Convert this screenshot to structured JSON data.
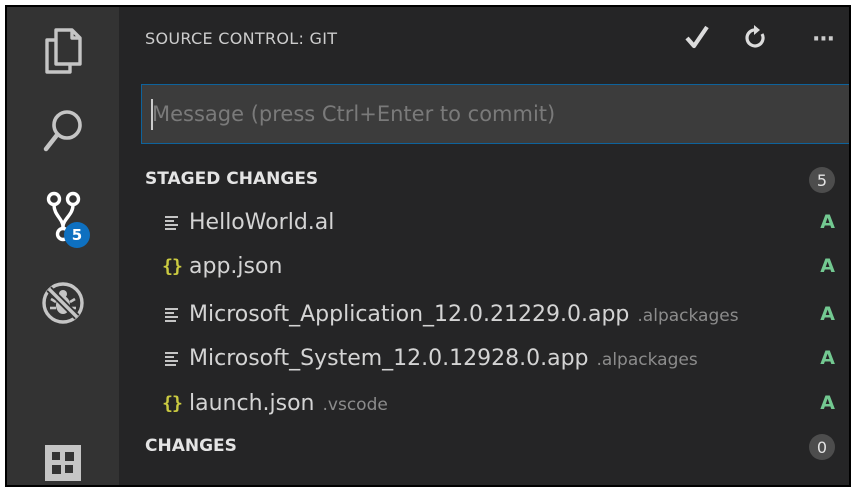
{
  "activity_bar": {
    "items": [
      {
        "icon": "files-icon"
      },
      {
        "icon": "search-icon"
      },
      {
        "icon": "source-control-icon",
        "badge": "5"
      },
      {
        "icon": "debug-icon"
      },
      {
        "icon": "extensions-icon"
      }
    ]
  },
  "panel": {
    "title": "SOURCE CONTROL: GIT",
    "actions": [
      "commit-check-icon",
      "refresh-icon",
      "more-icon"
    ],
    "more_label": "···",
    "message_placeholder": "Message (press Ctrl+Enter to commit)",
    "message_value": ""
  },
  "staged": {
    "label": "STAGED CHANGES",
    "count": "5",
    "files": [
      {
        "name": "HelloWorld.al",
        "dir": "",
        "status": "A",
        "icon": "text-file-icon"
      },
      {
        "name": "app.json",
        "dir": "",
        "status": "A",
        "icon": "json-icon"
      },
      {
        "name": "Microsoft_Application_12.0.21229.0.app",
        "dir": ".alpackages",
        "status": "A",
        "icon": "text-file-icon"
      },
      {
        "name": "Microsoft_System_12.0.12928.0.app",
        "dir": ".alpackages",
        "status": "A",
        "icon": "text-file-icon"
      },
      {
        "name": "launch.json",
        "dir": ".vscode",
        "status": "A",
        "icon": "json-icon"
      }
    ]
  },
  "changes": {
    "label": "CHANGES",
    "count": "0"
  },
  "json_icon_glyph": "{}",
  "colors": {
    "badge": "#0e70c0",
    "added": "#73c991",
    "json_icon": "#cbcb41",
    "focus_border": "#0e639c"
  }
}
